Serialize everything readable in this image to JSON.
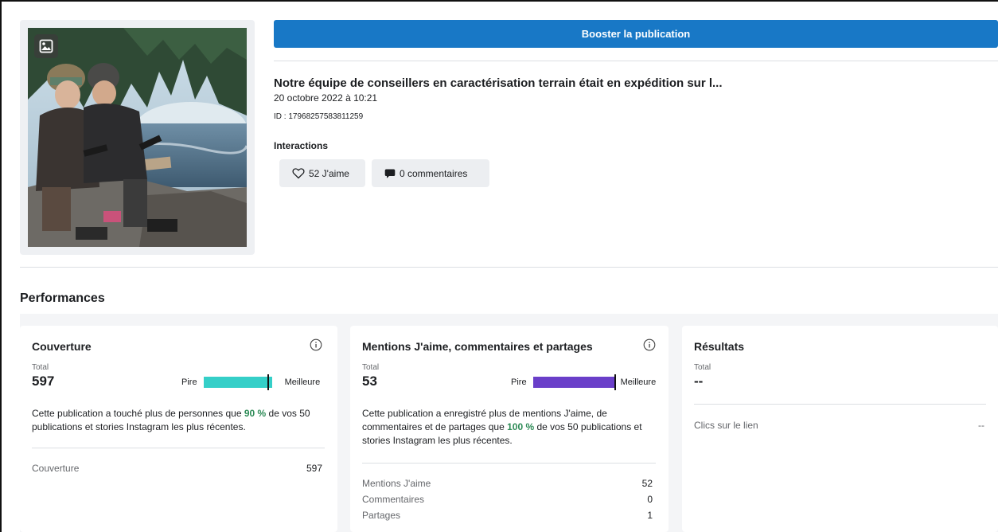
{
  "boost_button": {
    "label": "Booster la publication"
  },
  "post": {
    "title": "Notre équipe de conseillers en caractérisation terrain était en expédition sur l...",
    "date": "20 octobre 2022 à 10:21",
    "id": "ID : 17968257583811259",
    "interactions_label": "Interactions",
    "likes_pill": "52 J'aime",
    "comments_pill": "0 commentaires"
  },
  "performances": {
    "title": "Performances",
    "cards": [
      {
        "title": "Couverture",
        "total_label": "Total",
        "total_value": "597",
        "scale_low": "Pire",
        "scale_high": "Meilleure",
        "percentile": 0.9,
        "bar_color": "#35cfc8",
        "desc_before": "Cette publication a touché plus de personnes que ",
        "desc_pct": "90 %",
        "desc_after": " de vos 50 publications et stories Instagram les plus récentes.",
        "metrics": [
          {
            "label": "Couverture",
            "value": "597"
          }
        ]
      },
      {
        "title": "Mentions J'aime, commentaires et partages",
        "total_label": "Total",
        "total_value": "53",
        "scale_low": "Pire",
        "scale_high": "Meilleure",
        "percentile": 1.0,
        "bar_color": "#6a3fc9",
        "desc_before": "Cette publication a enregistré plus de mentions J'aime, de commentaires et de partages que ",
        "desc_pct": "100 %",
        "desc_after": " de vos 50 publications et stories Instagram les plus récentes.",
        "metrics": [
          {
            "label": "Mentions J'aime",
            "value": "52"
          },
          {
            "label": "Commentaires",
            "value": "0"
          },
          {
            "label": "Partages",
            "value": "1"
          }
        ]
      },
      {
        "title": "Résultats",
        "total_label": "Total",
        "total_value": "--",
        "metrics": [
          {
            "label": "Clics sur le lien",
            "value": "--"
          }
        ]
      }
    ]
  },
  "icons": {
    "photo_badge": "image-icon",
    "likes": "heart-icon",
    "comments": "speech-bubble-icon",
    "info": "info-icon"
  }
}
